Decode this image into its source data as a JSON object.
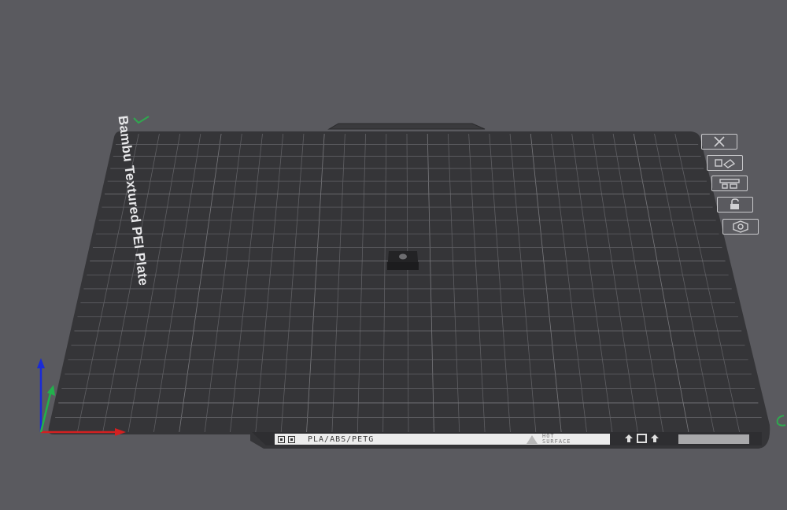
{
  "plate": {
    "title": "Bambu Textured PEI Plate",
    "label_material": "PLA/ABS/PETG",
    "label_warning": "HOT\nSURFACE"
  },
  "side_toolbar": [
    {
      "name": "delete-plate-button",
      "icon": "close-icon"
    },
    {
      "name": "arrange-button",
      "icon": "arrange-icon"
    },
    {
      "name": "orient-button",
      "icon": "orient-icon"
    },
    {
      "name": "lock-button",
      "icon": "lock-icon"
    },
    {
      "name": "plate-settings-button",
      "icon": "gear-icon"
    }
  ],
  "axes": {
    "x_color": "#d42020",
    "y_color": "#22b14c",
    "z_color": "#1a2bd6"
  },
  "colors": {
    "background": "#5a5a5f",
    "plate": "#353538",
    "grid": "#6a6a6e"
  }
}
